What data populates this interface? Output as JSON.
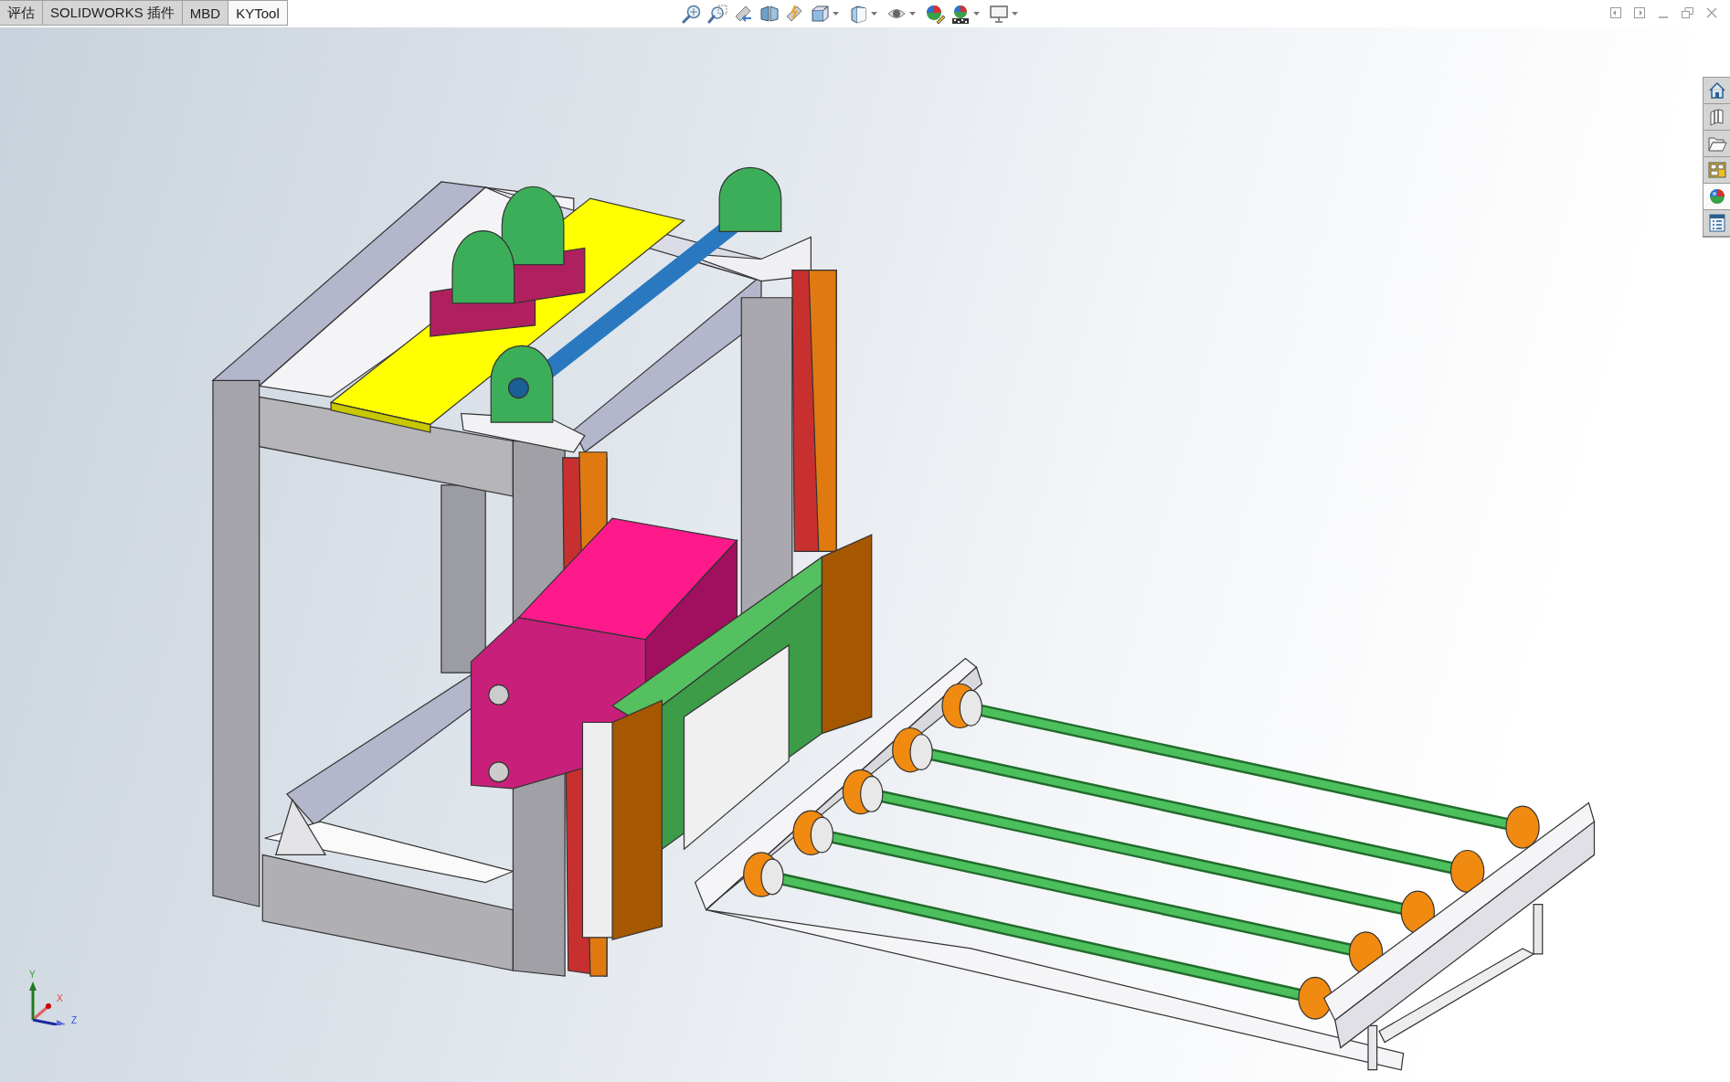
{
  "tabs": [
    {
      "label": "评估",
      "selected": false
    },
    {
      "label": "SOLIDWORKS 插件",
      "selected": false
    },
    {
      "label": "MBD",
      "selected": false
    },
    {
      "label": "KYTool",
      "selected": true
    }
  ],
  "task_pane": {
    "items": [
      {
        "selected": false
      },
      {
        "selected": false
      },
      {
        "selected": false
      },
      {
        "selected": false
      },
      {
        "selected": true
      },
      {
        "selected": false
      }
    ]
  },
  "triad": {
    "x_label": "X",
    "y_label": "Y",
    "z_label": "Z"
  }
}
